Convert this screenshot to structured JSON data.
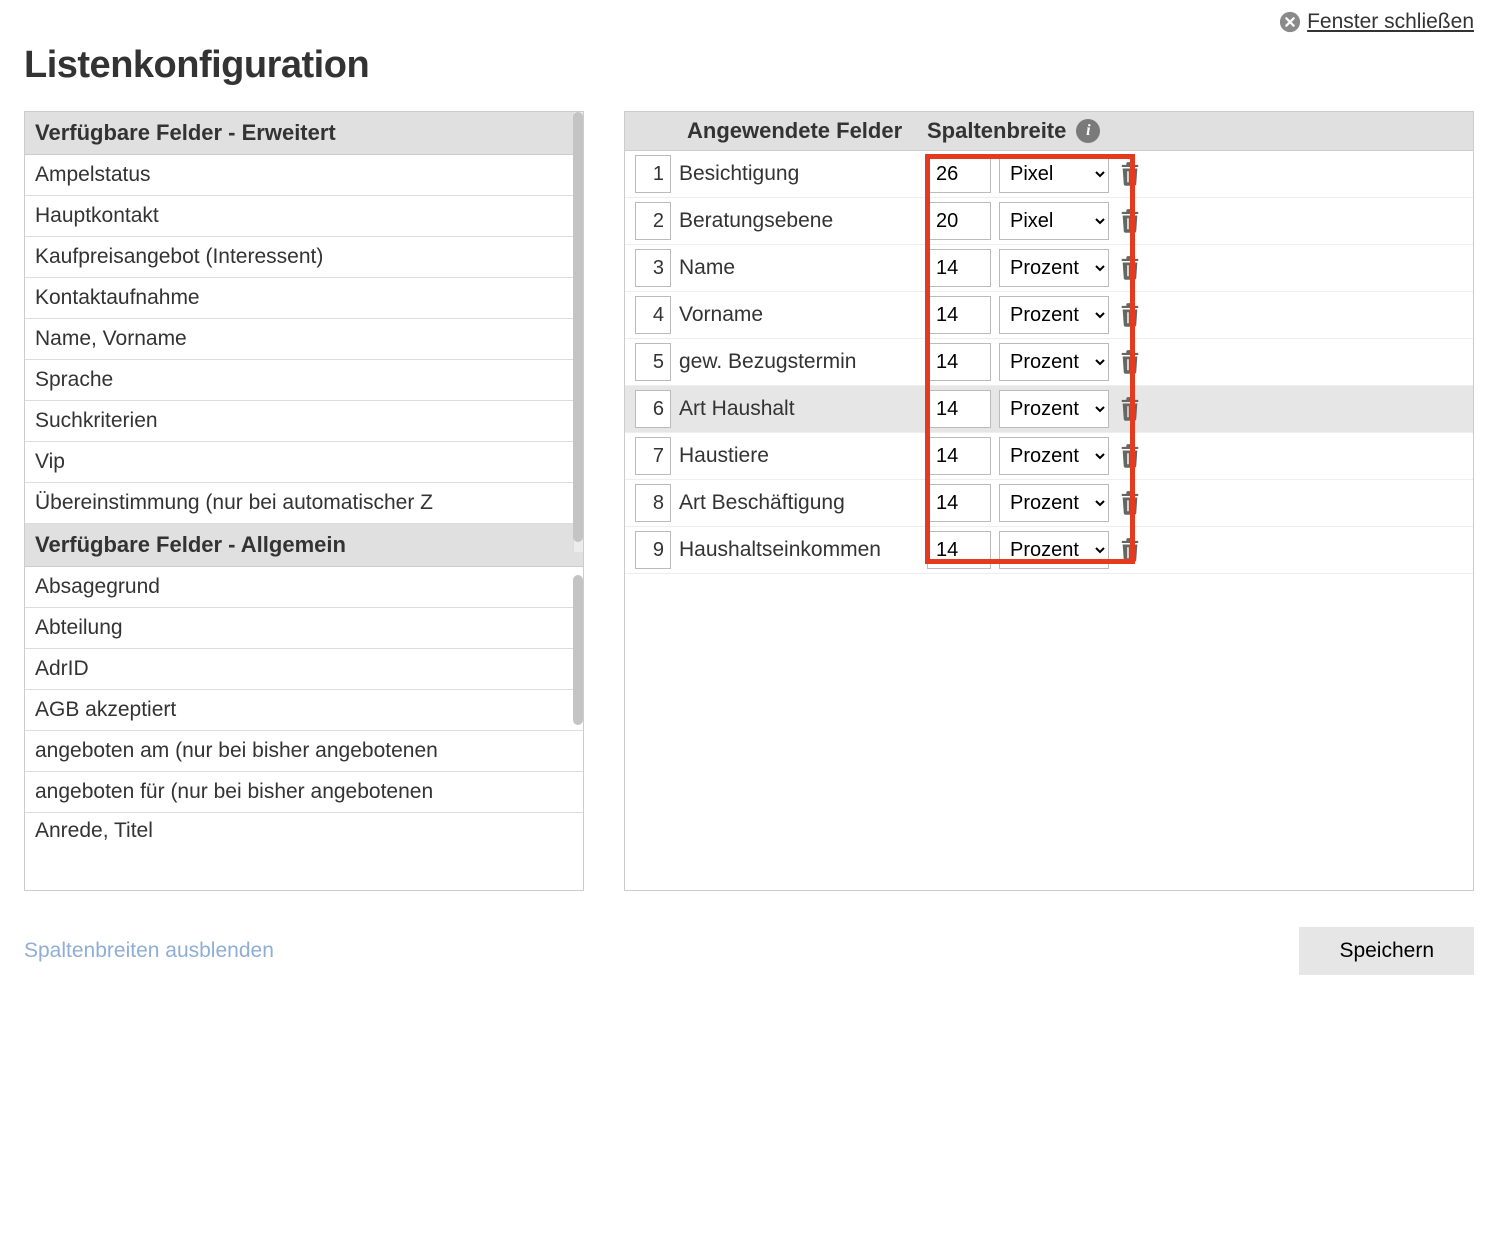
{
  "close_label": "Fenster schließen",
  "title": "Listenkonfiguration",
  "available": {
    "section_extended": "Verfügbare Felder - Erweitert",
    "extended_items": [
      "Ampelstatus",
      "Hauptkontakt",
      "Kaufpreisangebot (Interessent)",
      "Kontaktaufnahme",
      "Name, Vorname",
      "Sprache",
      "Suchkriterien",
      "Vip",
      "Übereinstimmung (nur bei automatischer Z"
    ],
    "section_general": "Verfügbare Felder - Allgemein",
    "general_items": [
      "Absagegrund",
      "Abteilung",
      "AdrID",
      "AGB akzeptiert",
      "angeboten am (nur bei bisher angebotenen",
      "angeboten für (nur bei bisher angebotenen",
      "Anrede, Titel"
    ]
  },
  "applied_header": {
    "applied": "Angewendete Felder",
    "width": "Spaltenbreite"
  },
  "unit_options": [
    "Pixel",
    "Prozent"
  ],
  "applied_rows": [
    {
      "idx": "1",
      "name": "Besichtigung",
      "width": "26",
      "unit": "Pixel"
    },
    {
      "idx": "2",
      "name": "Beratungsebene",
      "width": "20",
      "unit": "Pixel"
    },
    {
      "idx": "3",
      "name": "Name",
      "width": "14",
      "unit": "Prozent"
    },
    {
      "idx": "4",
      "name": "Vorname",
      "width": "14",
      "unit": "Prozent"
    },
    {
      "idx": "5",
      "name": "gew. Bezugstermin",
      "width": "14",
      "unit": "Prozent"
    },
    {
      "idx": "6",
      "name": "Art Haushalt",
      "width": "14",
      "unit": "Prozent",
      "hover": true
    },
    {
      "idx": "7",
      "name": "Haustiere",
      "width": "14",
      "unit": "Prozent"
    },
    {
      "idx": "8",
      "name": "Art Beschäftigung",
      "width": "14",
      "unit": "Prozent"
    },
    {
      "idx": "9",
      "name": "Haushaltseinkommen",
      "width": "14",
      "unit": "Prozent"
    }
  ],
  "footer": {
    "hide_widths": "Spaltenbreiten ausblenden",
    "save": "Speichern"
  }
}
